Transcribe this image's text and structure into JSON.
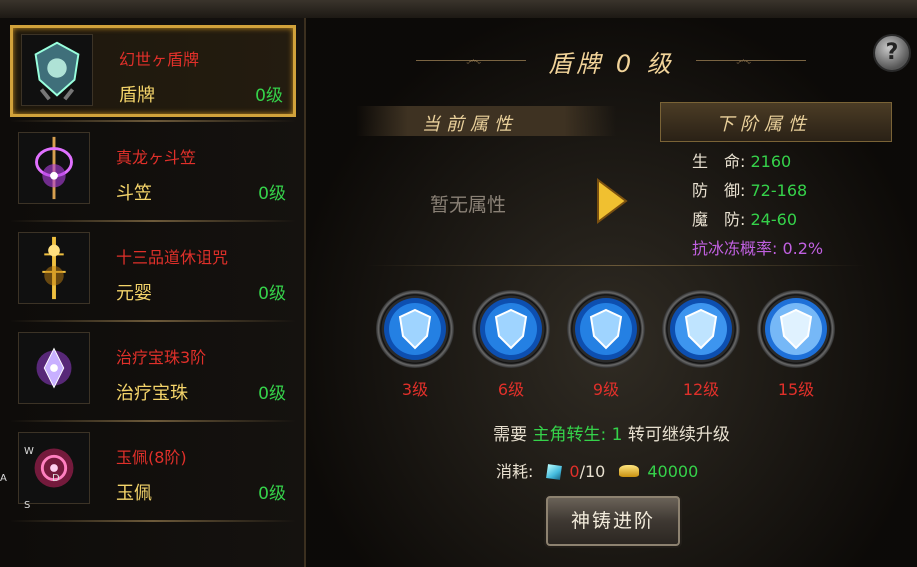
{
  "list": [
    {
      "name": "幻世ヶ盾牌",
      "type": "盾牌",
      "level": "0级",
      "selected": true
    },
    {
      "name": "真龙ヶ斗笠",
      "type": "斗笠",
      "level": "0级",
      "selected": false
    },
    {
      "name": "十三品道休诅咒",
      "type": "元婴",
      "level": "0级",
      "selected": false
    },
    {
      "name": "治疗宝珠3阶",
      "type": "治疗宝珠",
      "level": "0级",
      "selected": false
    },
    {
      "name": "玉佩(8阶)",
      "type": "玉佩",
      "level": "0级",
      "selected": false
    }
  ],
  "keys": {
    "w": "W",
    "a": "A",
    "d": "D",
    "s": "S"
  },
  "detail": {
    "title": "盾牌 0 级",
    "help_icon": "?",
    "current_header": "当前属性",
    "next_header": "下阶属性",
    "no_attr": "暂无属性",
    "next_attrs": [
      {
        "label": "生　命:",
        "value": "2160"
      },
      {
        "label": "防　御:",
        "value": "72-168"
      },
      {
        "label": "魔　防:",
        "value": "24-60"
      }
    ],
    "special_attr": "抗冰冻概率: 0.2%",
    "milestones": [
      "3级",
      "6级",
      "9级",
      "12级",
      "15级"
    ],
    "need_prefix": "需要",
    "need_cond": "主角转生: 1",
    "need_suffix": "转可继续升级",
    "cost_label": "消耗:",
    "cost_gem_have": "0",
    "cost_gem_total": "/10",
    "cost_gold": "40000",
    "forge_button": "神铸进阶"
  },
  "colors": {
    "accent": "#d1a23b",
    "name_red": "#e0302a",
    "level_green": "#35d24a",
    "type_yellow": "#f4d46a"
  }
}
